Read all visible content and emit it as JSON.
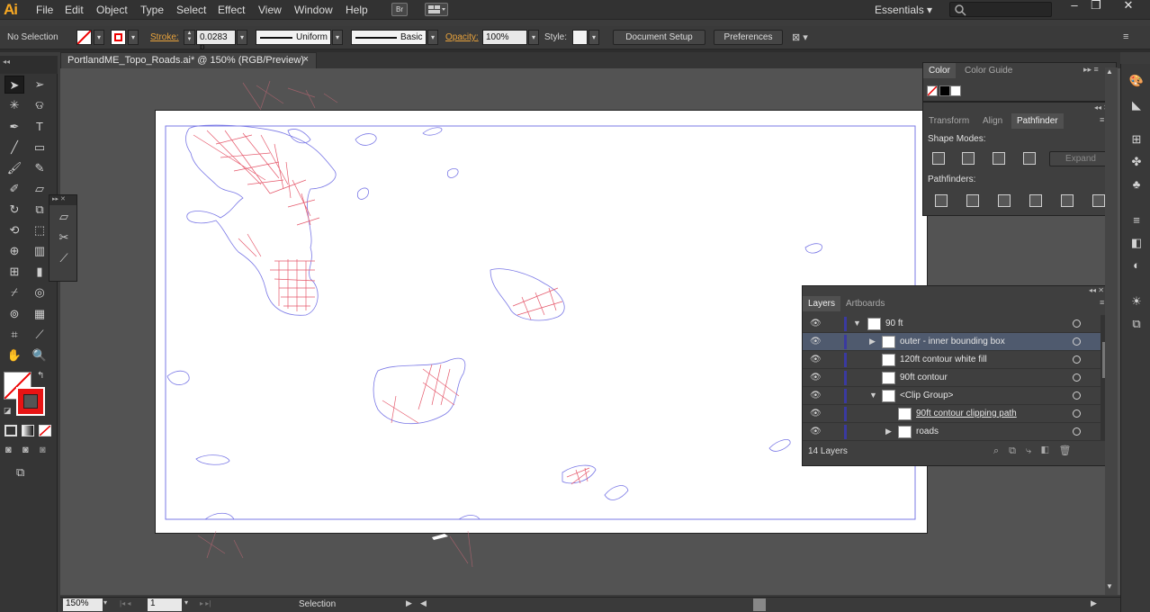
{
  "app": {
    "logo": "Ai"
  },
  "menu": [
    "File",
    "Edit",
    "Object",
    "Type",
    "Select",
    "Effect",
    "View",
    "Window",
    "Help"
  ],
  "topbar": {
    "bridge_label": "Br",
    "workspace": "Essentials",
    "workspace_arrow": "▾",
    "search_placeholder": ""
  },
  "window_controls": {
    "minimize": "–",
    "restore": "❐",
    "close": "✕"
  },
  "control": {
    "selection_text": "No Selection",
    "stroke_label": "Stroke:",
    "stroke_value": "0.0283 p",
    "profile_label": "Uniform",
    "brush_label": "Basic",
    "opacity_label": "Opacity:",
    "opacity_value": "100%",
    "style_label": "Style:",
    "document_setup": "Document Setup",
    "preferences": "Preferences"
  },
  "document_tab": {
    "title": "PortlandME_Topo_Roads.ai* @ 150% (RGB/Preview)",
    "close": "×"
  },
  "color_panel": {
    "tabs": [
      "Color",
      "Color Guide"
    ],
    "active": 0
  },
  "pathfinder_panel": {
    "tabs": [
      "Transform",
      "Align",
      "Pathfinder"
    ],
    "active": 2,
    "shape_modes_label": "Shape Modes:",
    "pathfinders_label": "Pathfinders:",
    "expand_label": "Expand"
  },
  "layers_panel": {
    "tabs": [
      "Layers",
      "Artboards"
    ],
    "active": 0,
    "rows": [
      {
        "name": "90 ft",
        "indent": 0,
        "expanded": true,
        "selected": false,
        "underline": false
      },
      {
        "name": "outer - inner bounding box",
        "indent": 1,
        "expanded": false,
        "has_arrow": true,
        "selected": true,
        "underline": false
      },
      {
        "name": "120ft contour white fill",
        "indent": 1,
        "expanded": false,
        "selected": false,
        "underline": false
      },
      {
        "name": "90ft contour",
        "indent": 1,
        "expanded": false,
        "selected": false,
        "underline": false
      },
      {
        "name": "<Clip Group>",
        "indent": 1,
        "expanded": true,
        "has_arrow": true,
        "selected": false,
        "underline": false
      },
      {
        "name": "90ft contour clipping path",
        "indent": 2,
        "expanded": false,
        "selected": false,
        "underline": true
      },
      {
        "name": "roads",
        "indent": 2,
        "expanded": false,
        "has_arrow": true,
        "selected": false,
        "underline": false
      }
    ],
    "count": "14 Layers"
  },
  "status": {
    "zoom": "150%",
    "artboard_num": "1",
    "tool": "Selection"
  },
  "colors": {
    "accent_orange": "#f7a823",
    "contour": "#6a6ae8",
    "roads": "#e84a5f",
    "selected_row": "#4f5a6e"
  }
}
